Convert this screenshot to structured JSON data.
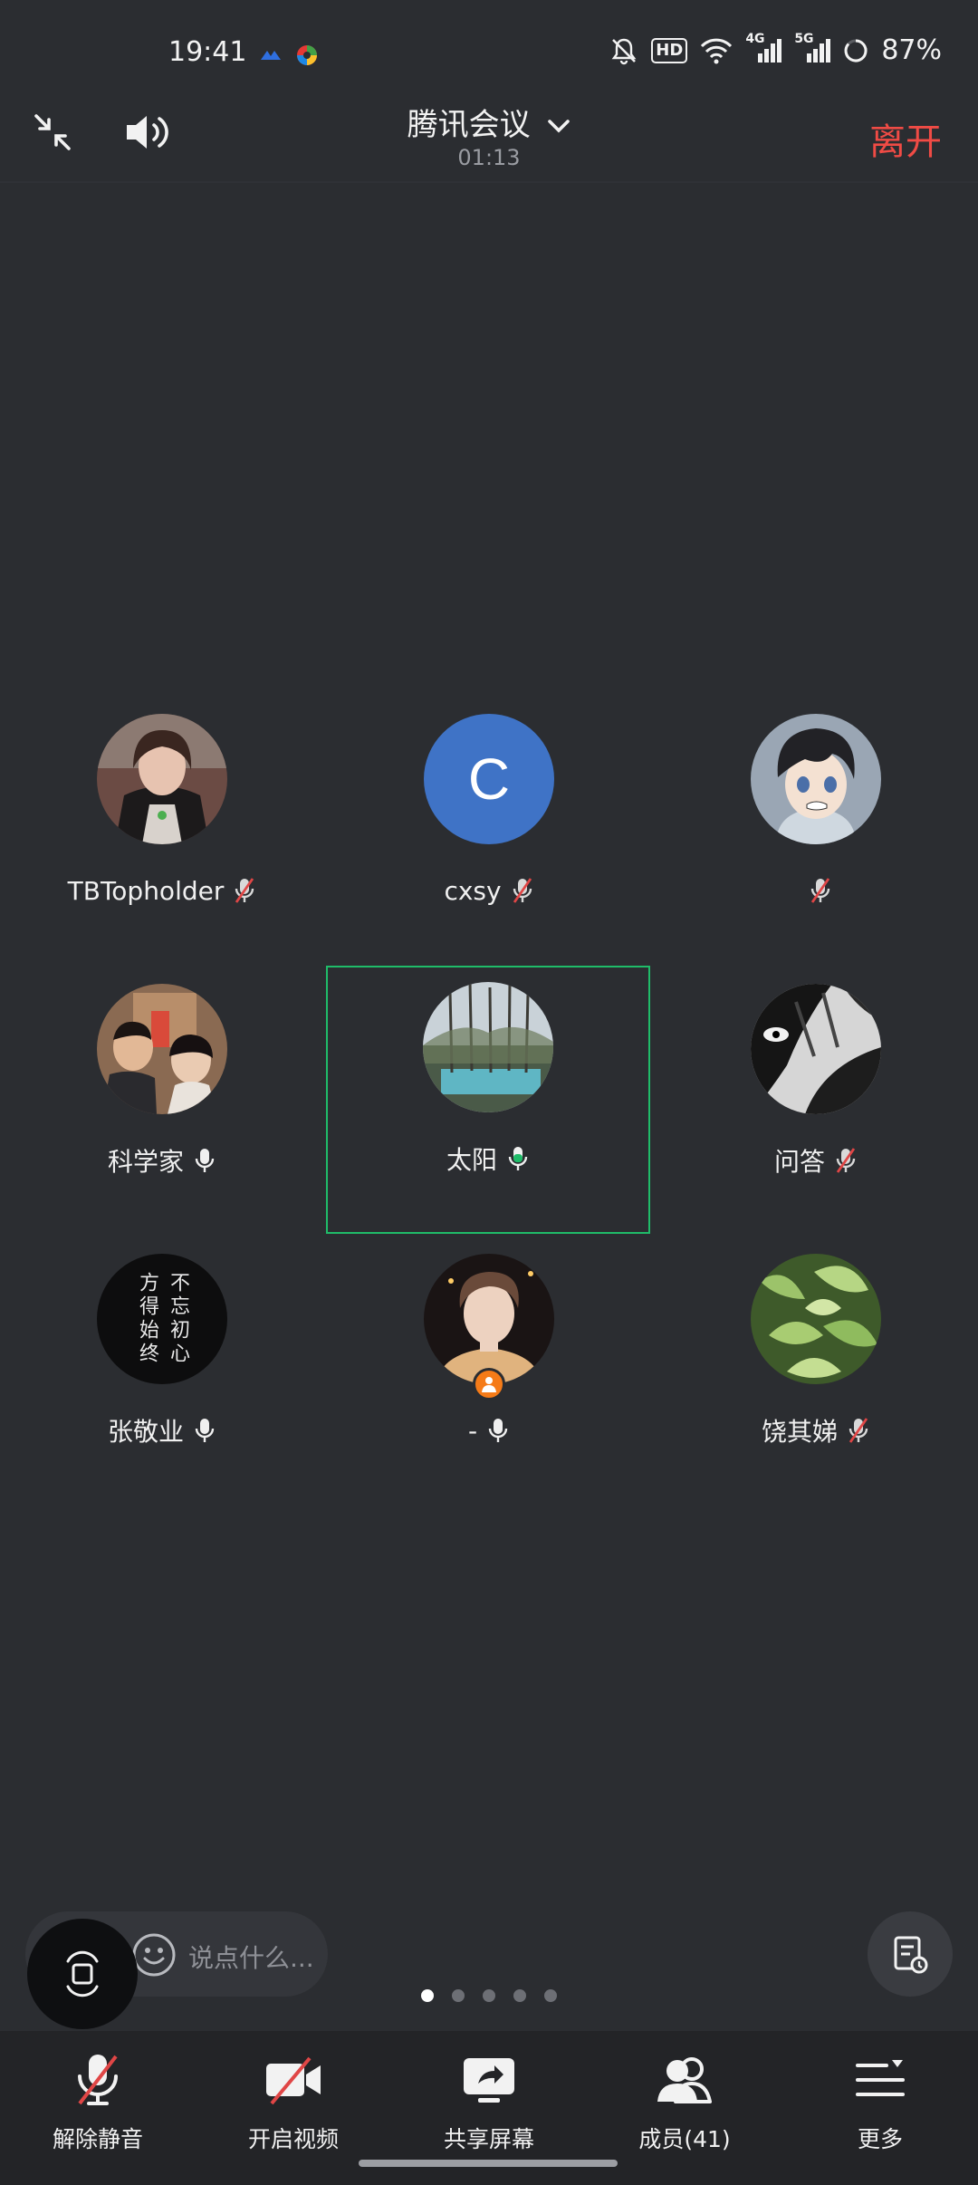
{
  "status_bar": {
    "time": "19:41",
    "hd_badge": "HD",
    "network_4g": "4G",
    "network_5g": "5G",
    "battery": "87%"
  },
  "header": {
    "title": "腾讯会议",
    "timer": "01:13",
    "leave_label": "离开"
  },
  "participants": [
    {
      "name": "TBTopholder",
      "mic": "muted",
      "avatar": "photo-woman",
      "avatar_letter": ""
    },
    {
      "name": "cxsy",
      "mic": "muted",
      "avatar": "letter",
      "avatar_letter": "C"
    },
    {
      "name": "",
      "mic": "muted",
      "avatar": "anime-boy",
      "avatar_letter": ""
    },
    {
      "name": "科学家",
      "mic": "on",
      "avatar": "photo-kids",
      "avatar_letter": ""
    },
    {
      "name": "太阳",
      "mic": "speaking",
      "avatar": "photo-trees",
      "avatar_letter": ""
    },
    {
      "name": "问答",
      "mic": "muted",
      "avatar": "bw-art",
      "avatar_letter": ""
    },
    {
      "name": "张敬业",
      "mic": "on",
      "avatar": "calligraphy",
      "avatar_letter": ""
    },
    {
      "name": "-",
      "mic": "on",
      "avatar": "photo-man",
      "avatar_letter": "",
      "host": true
    },
    {
      "name": "饶其娣",
      "mic": "muted",
      "avatar": "photo-plant",
      "avatar_letter": ""
    }
  ],
  "calligraphy_text": "不忘初心 方得始终",
  "chat": {
    "placeholder": "说点什么..."
  },
  "pager": {
    "pages": 5,
    "current": 1
  },
  "toolbar": [
    {
      "label": "解除静音",
      "icon": "mic-off-icon"
    },
    {
      "label": "开启视频",
      "icon": "video-off-icon"
    },
    {
      "label": "共享屏幕",
      "icon": "share-screen-icon"
    },
    {
      "label": "成员(41)",
      "icon": "members-icon"
    },
    {
      "label": "更多",
      "icon": "more-icon"
    }
  ],
  "colors": {
    "background": "#2b2d31",
    "toolbar": "#232427",
    "leave": "#f04b45",
    "speaking": "#1fbc69",
    "muted_slash": "#e04646",
    "avatar_letter_bg": "#3f73c6"
  }
}
